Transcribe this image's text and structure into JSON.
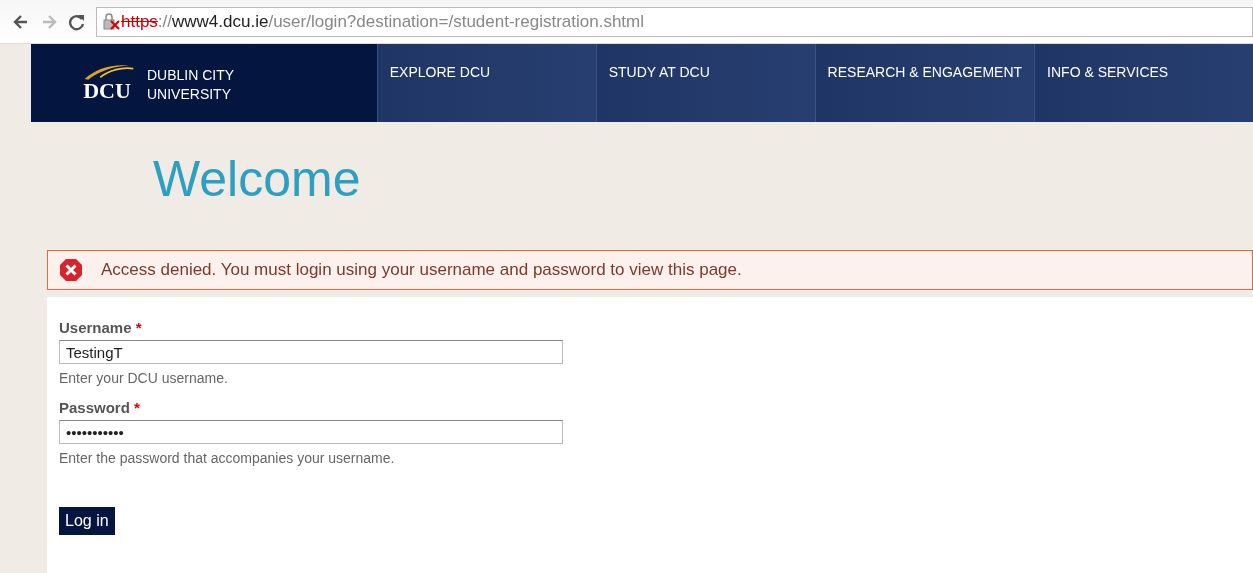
{
  "browser": {
    "url": {
      "scheme": "https",
      "separator": "://",
      "host": "www4.dcu.ie",
      "path": "/user/login?destination=/student-registration.shtml"
    },
    "insecure": true,
    "forward_disabled": true
  },
  "header": {
    "logo_mark": "DCU",
    "logo_text": [
      "DUBLIN CITY",
      "UNIVERSITY"
    ],
    "nav": [
      {
        "label": "EXPLORE DCU"
      },
      {
        "label": "STUDY AT DCU"
      },
      {
        "label": "RESEARCH & ENGAGEMENT"
      },
      {
        "label": "INFO & SERVICES"
      }
    ]
  },
  "title": "Welcome",
  "message": {
    "kind": "error",
    "text": "Access denied. You must login using your username and password to view this page."
  },
  "form": {
    "fields": [
      {
        "label": "Username",
        "required": true,
        "value": "TestingT",
        "help": "Enter your DCU username."
      },
      {
        "label": "Password",
        "required": true,
        "value": "•••••••••••",
        "help": "Enter the password that accompanies your username."
      }
    ],
    "required_mark": "*",
    "submit": "Log in"
  }
}
